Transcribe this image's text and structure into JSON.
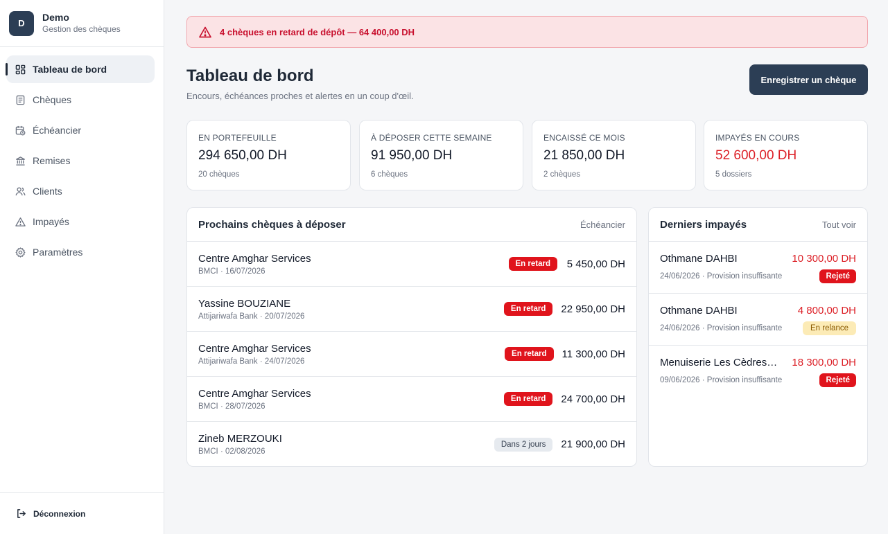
{
  "brand": {
    "initial": "D",
    "name": "Demo",
    "subtitle": "Gestion des chèques"
  },
  "nav": [
    {
      "label": "Tableau de bord",
      "icon": "dashboard-icon",
      "active": true
    },
    {
      "label": "Chèques",
      "icon": "document-icon"
    },
    {
      "label": "Échéancier",
      "icon": "calendar-icon"
    },
    {
      "label": "Remises",
      "icon": "bank-icon"
    },
    {
      "label": "Clients",
      "icon": "users-icon"
    },
    {
      "label": "Impayés",
      "icon": "warning-icon"
    },
    {
      "label": "Paramètres",
      "icon": "gear-icon"
    }
  ],
  "logout": {
    "label": "Déconnexion",
    "icon": "logout-icon"
  },
  "alert": {
    "text": "4 chèques en retard de dépôt — 64 400,00 DH",
    "icon": "warning-icon",
    "color": "#c8102e"
  },
  "header": {
    "title": "Tableau de bord",
    "subtitle": "Encours, échéances proches et alertes en un coup d'œil.",
    "primary_action": "Enregistrer un chèque"
  },
  "kpis": [
    {
      "label": "EN PORTEFEUILLE",
      "value": "294 650,00 DH",
      "sub": "20 chèques"
    },
    {
      "label": "À DÉPOSER CETTE SEMAINE",
      "value": "91 950,00 DH",
      "sub": "6 chèques"
    },
    {
      "label": "ENCAISSÉ CE MOIS",
      "value": "21 850,00 DH",
      "sub": "2 chèques"
    },
    {
      "label": "IMPAYÉS EN COURS",
      "value": "52 600,00 DH",
      "sub": "5 dossiers",
      "danger": true
    }
  ],
  "upcoming": {
    "title": "Prochains chèques à déposer",
    "link": "Échéancier",
    "rows": [
      {
        "name": "Centre Amghar Services",
        "meta": "BMCI · 16/07/2026",
        "status": "En retard",
        "amount": "5 450,00 DH"
      },
      {
        "name": "Yassine BOUZIANE",
        "meta": "Attijariwafa Bank · 20/07/2026",
        "status": "En retard",
        "amount": "22 950,00 DH"
      },
      {
        "name": "Centre Amghar Services",
        "meta": "Attijariwafa Bank · 24/07/2026",
        "status": "En retard",
        "amount": "11 300,00 DH"
      },
      {
        "name": "Centre Amghar Services",
        "meta": "BMCI · 28/07/2026",
        "status": "En retard",
        "amount": "24 700,00 DH"
      },
      {
        "name": "Zineb MERZOUKI",
        "meta": "BMCI · 02/08/2026",
        "status": "Dans 2 jours",
        "amount": "21 900,00 DH"
      }
    ]
  },
  "unpaid": {
    "title": "Derniers impayés",
    "link": "Tout voir",
    "rows": [
      {
        "name": "Othmane DAHBI",
        "amount": "10 300,00 DH",
        "meta": "24/06/2026 · Provision insuffisante",
        "status": "Rejeté"
      },
      {
        "name": "Othmane DAHBI",
        "amount": "4 800,00 DH",
        "meta": "24/06/2026 · Provision insuffisante",
        "status": "En relance"
      },
      {
        "name": "Menuiserie Les Cèdres…",
        "amount": "18 300,00 DH",
        "meta": "09/06/2026 · Provision insuffisante",
        "status": "Rejeté"
      }
    ]
  },
  "colors": {
    "primary": "#2c3e55",
    "danger": "#e0141c",
    "warning_bg": "#fcebb6"
  }
}
